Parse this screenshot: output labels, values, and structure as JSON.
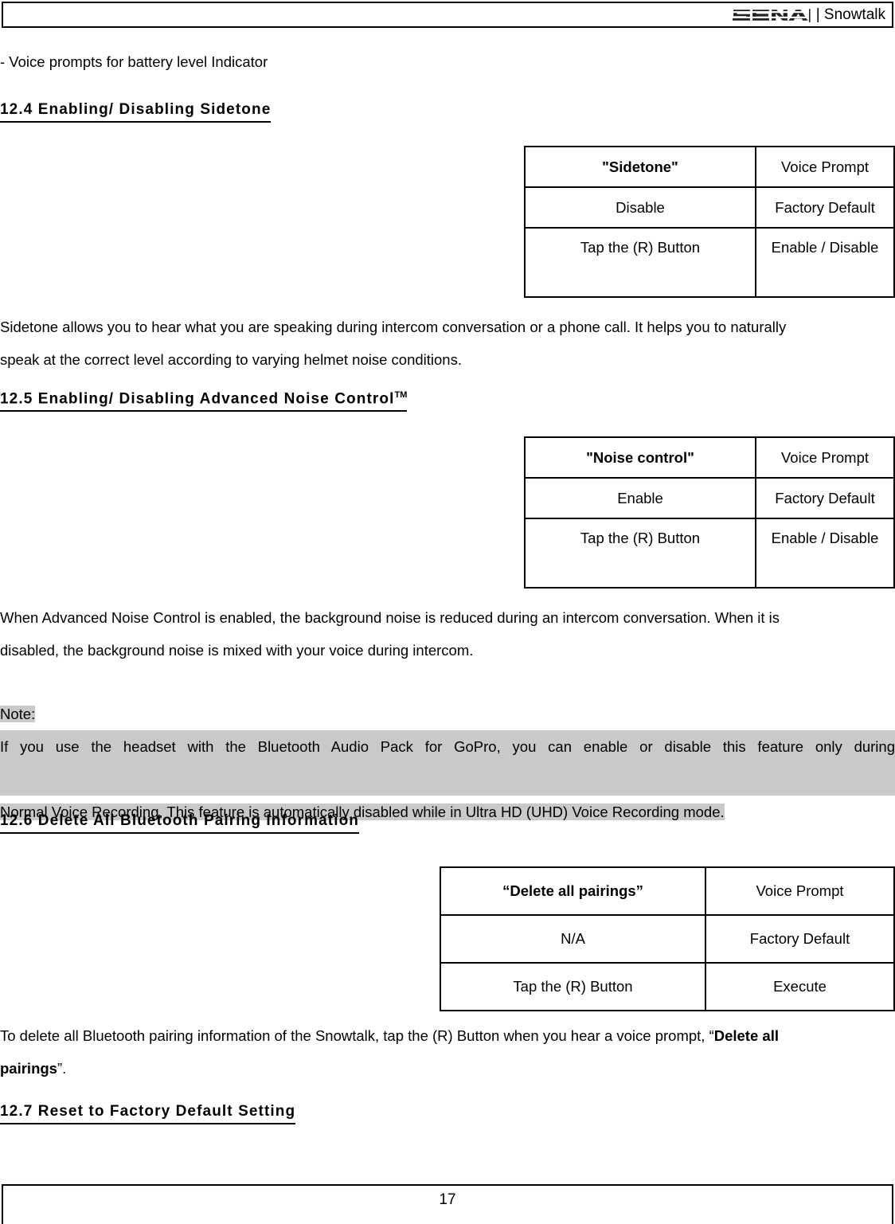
{
  "header": {
    "logo_name": "SENA",
    "brand_suffix": "| Snowtalk"
  },
  "content": {
    "bullet_line": "- Voice prompts for battery level Indicator",
    "sections": [
      {
        "id": "12.4",
        "heading": "12.4 Enabling/ Disabling Sidetone",
        "has_tm": false
      },
      {
        "id": "12.5",
        "heading": "12.5 Enabling/ Disabling Advanced Noise Control",
        "tm": "TM",
        "has_tm": true
      },
      {
        "id": "12.6",
        "heading": "12.6 Delete All Bluetooth Pairing Information",
        "has_tm": false
      },
      {
        "id": "12.7",
        "heading": "12.7 Reset to Factory Default Setting",
        "has_tm": false
      }
    ],
    "tables": [
      {
        "name": "sidetone-table",
        "rows": [
          {
            "left": "\"Sidetone\"",
            "right": "Voice Prompt",
            "left_bold": true
          },
          {
            "left": "Disable",
            "right": "Factory Default",
            "left_bold": false
          },
          {
            "left": "Tap the (R) Button",
            "right": "Enable / Disable",
            "left_bold": false
          }
        ]
      },
      {
        "name": "noise-control-table",
        "rows": [
          {
            "left": "\"Noise control\"",
            "right": "Voice Prompt",
            "left_bold": true
          },
          {
            "left": "Enable",
            "right": "Factory Default",
            "left_bold": false
          },
          {
            "left": "Tap the (R) Button",
            "right": "Enable / Disable",
            "left_bold": false
          }
        ]
      },
      {
        "name": "delete-pairings-table",
        "rows": [
          {
            "left": "“Delete all pairings”",
            "right": "Voice Prompt",
            "left_bold": true
          },
          {
            "left": "N/A",
            "right": "Factory Default",
            "left_bold": false
          },
          {
            "left": "Tap the (R) Button",
            "right": "Execute",
            "left_bold": false
          }
        ]
      }
    ],
    "paragraph_sidetone": {
      "line1": "Sidetone allows you to hear what you are speaking during intercom conversation or a phone call. It helps you to naturally",
      "line2": "speak at the correct level according to varying helmet noise conditions."
    },
    "paragraph_noise": {
      "line1": "When Advanced Noise Control is enabled, the background noise is reduced during an intercom conversation. When it is",
      "line2": "disabled, the background noise is mixed with your voice during intercom."
    },
    "note": {
      "label": "Note:",
      "line1": "If you use the headset with the Bluetooth Audio Pack for GoPro, you can enable or disable this feature only during",
      "line2": "Normal Voice Recording. This feature is automatically disabled while in Ultra HD (UHD) Voice Recording mode.",
      "highlight_color": "#c9c9c9"
    },
    "paragraph_delete": {
      "line1_pre": "To delete all Bluetooth pairing information of the Snowtalk, tap the (R) Button when you hear a voice prompt, “",
      "line1_bold": "Delete all",
      "line2_bold": "pairings",
      "line2_post": "”."
    }
  },
  "footer": {
    "page_number": "17"
  }
}
